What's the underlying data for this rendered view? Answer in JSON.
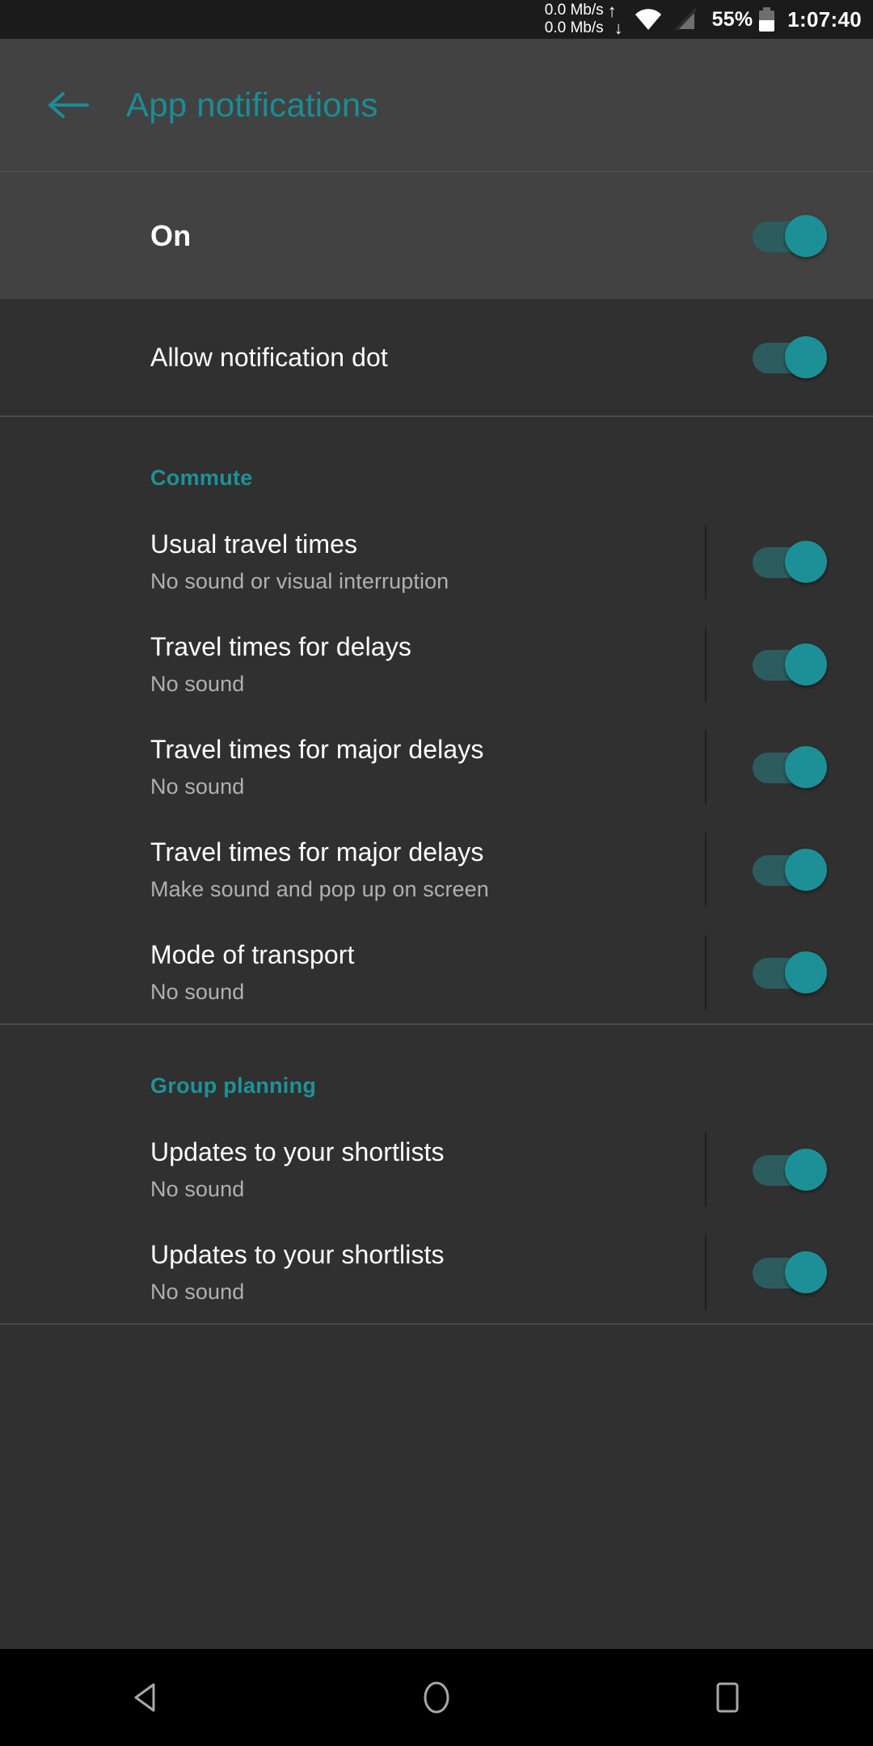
{
  "status_bar": {
    "net_up": "0.0 Mb/s",
    "net_down": "0.0 Mb/s",
    "up_arrow_icon": "arrow-up-icon",
    "down_arrow_icon": "arrow-down-icon",
    "wifi_icon": "wifi-icon",
    "signal_off_icon": "signal-disabled-icon",
    "battery_percent": "55%",
    "battery_icon": "battery-icon",
    "clock": "1:07:40"
  },
  "app_bar": {
    "back_icon": "back-arrow-icon",
    "title": "App notifications",
    "accent_color": "#1a8d94"
  },
  "master_switch": {
    "label": "On",
    "state": "on"
  },
  "top_settings": [
    {
      "title": "Allow notification dot",
      "state": "on"
    }
  ],
  "sections": [
    {
      "header": "Commute",
      "items": [
        {
          "title": "Usual travel times",
          "subtitle": "No sound or visual interruption",
          "state": "on"
        },
        {
          "title": "Travel times for delays",
          "subtitle": "No sound",
          "state": "on"
        },
        {
          "title": "Travel times for major delays",
          "subtitle": "No sound",
          "state": "on"
        },
        {
          "title": "Travel times for major delays",
          "subtitle": "Make sound and pop up on screen",
          "state": "on"
        },
        {
          "title": "Mode of transport",
          "subtitle": "No sound",
          "state": "on"
        }
      ]
    },
    {
      "header": "Group planning",
      "items": [
        {
          "title": "Updates to your shortlists",
          "subtitle": "No sound",
          "state": "on"
        },
        {
          "title": "Updates to your shortlists",
          "subtitle": "No sound",
          "state": "on"
        }
      ]
    }
  ],
  "nav_bar": {
    "back_icon": "nav-back-triangle-icon",
    "home_icon": "nav-home-circle-icon",
    "recents_icon": "nav-recents-square-icon"
  },
  "colors": {
    "background": "#303030",
    "surface_raised": "#424242",
    "accent_teal": "#1a8d94",
    "switch_thumb": "#1d9097",
    "switch_track": "#2d5c5f",
    "primary_text": "#ffffff",
    "secondary_text": "#b0b0b0"
  }
}
